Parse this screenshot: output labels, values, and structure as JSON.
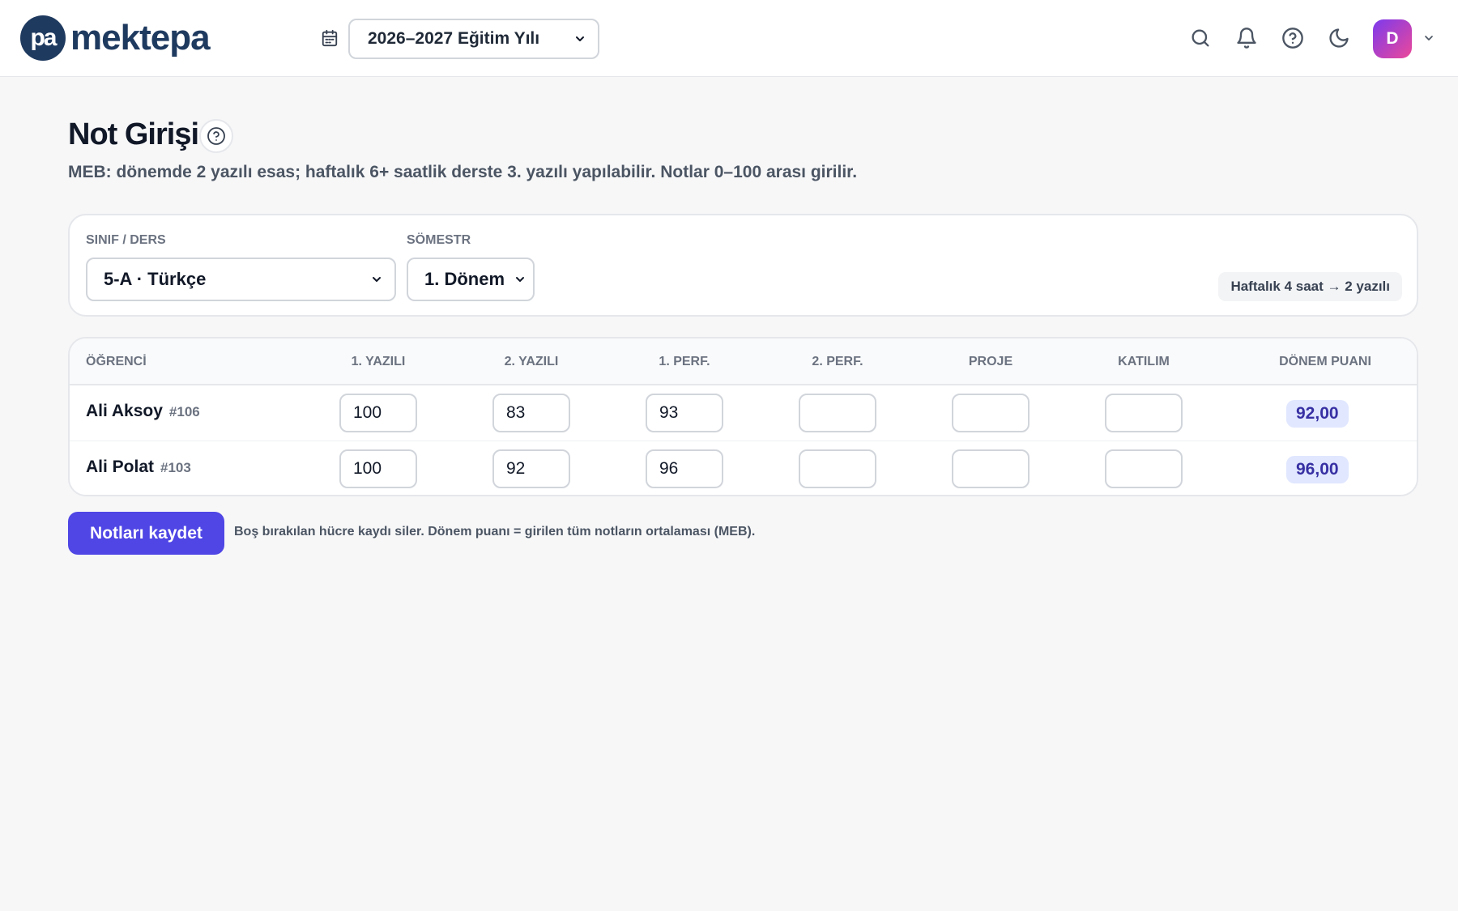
{
  "header": {
    "logo_mark": "pa",
    "logo_text": "mektepa",
    "academic_year": "2026–2027 Eğitim Yılı",
    "avatar_initial": "D"
  },
  "page": {
    "title": "Not Girişi",
    "subtitle": "MEB: dönemde 2 yazılı esas; haftalık 6+ saatlik derste 3. yazılı yapılabilir. Notlar 0–100 arası girilir."
  },
  "filters": {
    "class_label": "SINIF / DERS",
    "class_value": "5-A · Türkçe",
    "semester_label": "SÖMESTR",
    "semester_value": "1. Dönem",
    "info_chip": "Haftalık 4 saat → 2 yazılı"
  },
  "table": {
    "headers": [
      "ÖĞRENCİ",
      "1. YAZILI",
      "2. YAZILI",
      "1. PERF.",
      "2. PERF.",
      "PROJE",
      "KATILIM",
      "DÖNEM PUANI"
    ],
    "rows": [
      {
        "name": "Ali Aksoy",
        "id": "#106",
        "grades": [
          "100",
          "83",
          "93",
          "",
          "",
          ""
        ],
        "term_score": "92,00"
      },
      {
        "name": "Ali Polat",
        "id": "#103",
        "grades": [
          "100",
          "92",
          "96",
          "",
          "",
          ""
        ],
        "term_score": "96,00"
      }
    ]
  },
  "actions": {
    "save_label": "Notları kaydet",
    "save_hint": "Boş bırakılan hücre kaydı siler. Dönem puanı = girilen tüm notların ortalaması (MEB)."
  },
  "colors": {
    "accent": "#4f46e5",
    "brand": "#1f3a5f",
    "badge_bg": "#e0e7ff",
    "badge_text": "#3730a3"
  },
  "icons": [
    "calendar-icon",
    "search-icon",
    "bell-icon",
    "help-circle-icon",
    "moon-icon",
    "chevron-down-icon"
  ]
}
